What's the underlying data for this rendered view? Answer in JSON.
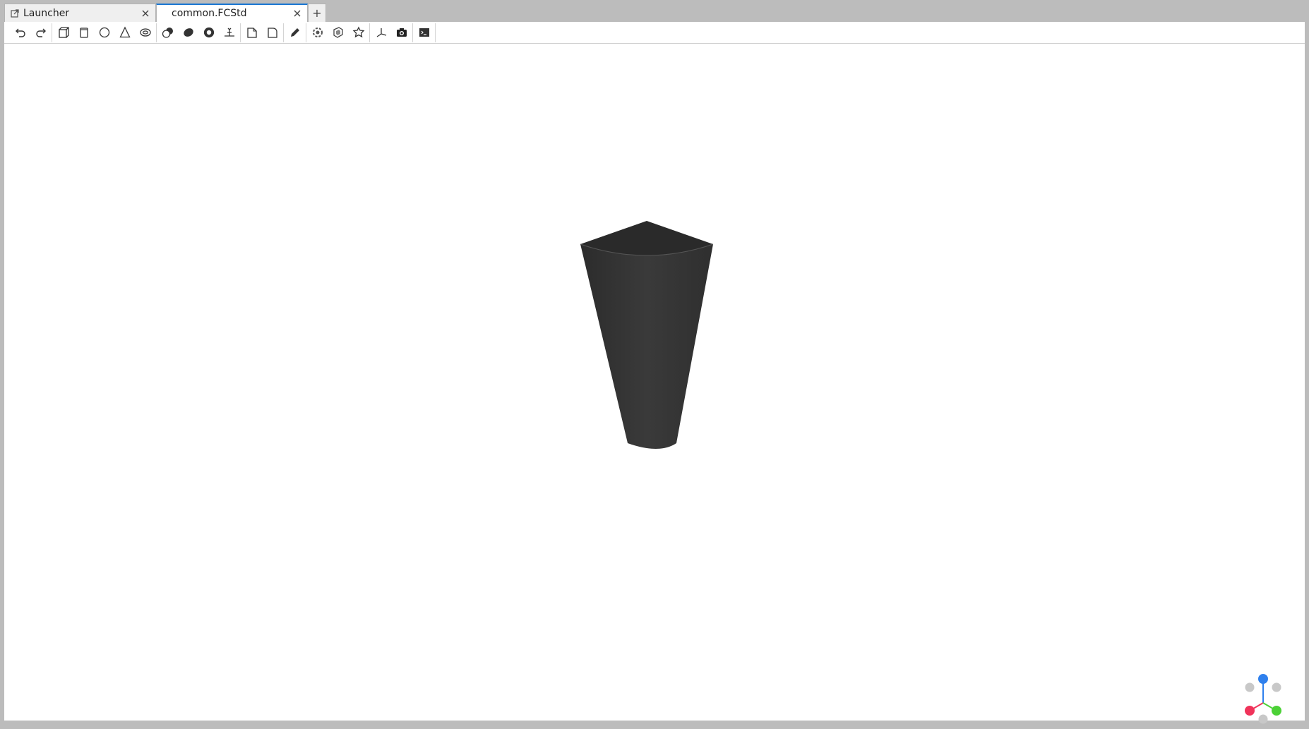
{
  "tabs": [
    {
      "label": "Launcher",
      "active": false
    },
    {
      "label": "common.FCStd",
      "active": true
    }
  ],
  "new_tab_label": "+",
  "toolbar": {
    "buttons": [
      "undo-icon",
      "redo-icon",
      "box-icon",
      "cylinder-icon",
      "sphere-icon",
      "cone-icon",
      "torus-icon",
      "union-icon",
      "intersection-icon",
      "difference-icon",
      "section-icon",
      "chamfer-icon",
      "fillet-icon",
      "sketch-icon",
      "extrude-icon",
      "revolve-icon",
      "polygon-icon",
      "axes-icon",
      "screenshot-icon",
      "console-icon"
    ]
  },
  "viewport": {
    "object": "cone-segment",
    "object_color": "#333333",
    "axis_colors": {
      "x": "#f0335a",
      "y": "#4cd137",
      "z": "#2f80ed"
    }
  }
}
